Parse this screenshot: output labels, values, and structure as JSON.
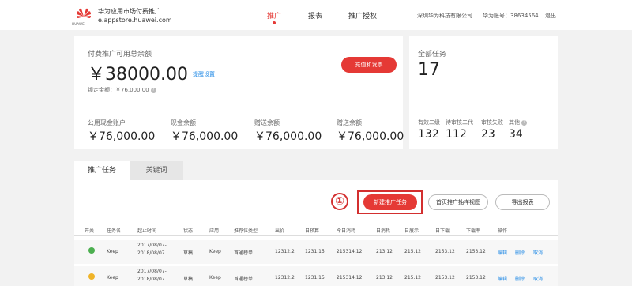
{
  "header": {
    "logo_text": "HUAWEI",
    "brand_title": "华为应用市场付费推广",
    "brand_url": "e.appstore.huawei.com",
    "nav": [
      "推广",
      "报表",
      "推广授权"
    ],
    "company": "深圳华为科技有限公司",
    "account": "华为账号：38634564",
    "logout": "退出"
  },
  "balance_card": {
    "title": "付费推广可用总余额",
    "amount": "￥38000.00",
    "reminder_link": "提醒设置",
    "locked": "锁定金额：￥76,000.00",
    "recharge_button": "充值和发票",
    "accounts": [
      {
        "label": "公用现金账户",
        "value": "￥76,000.00"
      },
      {
        "label": "现金余额",
        "value": "￥76,000.00"
      },
      {
        "label": "赠送余额",
        "value": "￥76,000.00"
      },
      {
        "label": "赠送余额",
        "value": "￥76,000.00"
      }
    ]
  },
  "tasks_card": {
    "title": "全部任务",
    "total": "17",
    "stats": [
      {
        "label": "有效二级",
        "value": "132"
      },
      {
        "label": "待审核二代",
        "value": "112"
      },
      {
        "label": "审核失败",
        "value": "23"
      },
      {
        "label": "其他",
        "value": "34"
      }
    ]
  },
  "tabs": [
    "推广任务",
    "关键词"
  ],
  "annotation": "①",
  "toolbar": {
    "new_task": "新建推广任务",
    "sample": "首页推广抽样视图",
    "export": "导出报表"
  },
  "table": {
    "headers": [
      "开关",
      "任务名",
      "起止时间",
      "状态",
      "应用",
      "推荐位类型",
      "出价",
      "日预算",
      "今日消耗",
      "日消耗",
      "日展示",
      "日下载",
      "下载率",
      "操作"
    ],
    "rows": [
      {
        "status_color": "#4caf50",
        "name": "Keep",
        "date_start": "2017/08/07-",
        "date_end": "2018/08/07",
        "state": "草稿",
        "app": "Keep",
        "slot": "首通榜单",
        "bid": "12312.2",
        "budget": "1231.15",
        "today": "215314.12",
        "daily_cost": "213.12",
        "shows": "215.12",
        "downloads": "2153.12",
        "rate": "2153.12",
        "actions": [
          "编辑",
          "删除",
          "取消"
        ]
      },
      {
        "status_color": "#f0b429",
        "name": "Keep",
        "date_start": "2017/08/07-",
        "date_end": "2018/08/07",
        "state": "草稿",
        "app": "Keep",
        "slot": "首通榜单",
        "bid": "12312.2",
        "budget": "1231.15",
        "today": "215314.12",
        "daily_cost": "213.12",
        "shows": "215.12",
        "downloads": "2153.12",
        "rate": "2153.12",
        "actions": [
          "编辑",
          "删除",
          "取消"
        ]
      }
    ]
  }
}
